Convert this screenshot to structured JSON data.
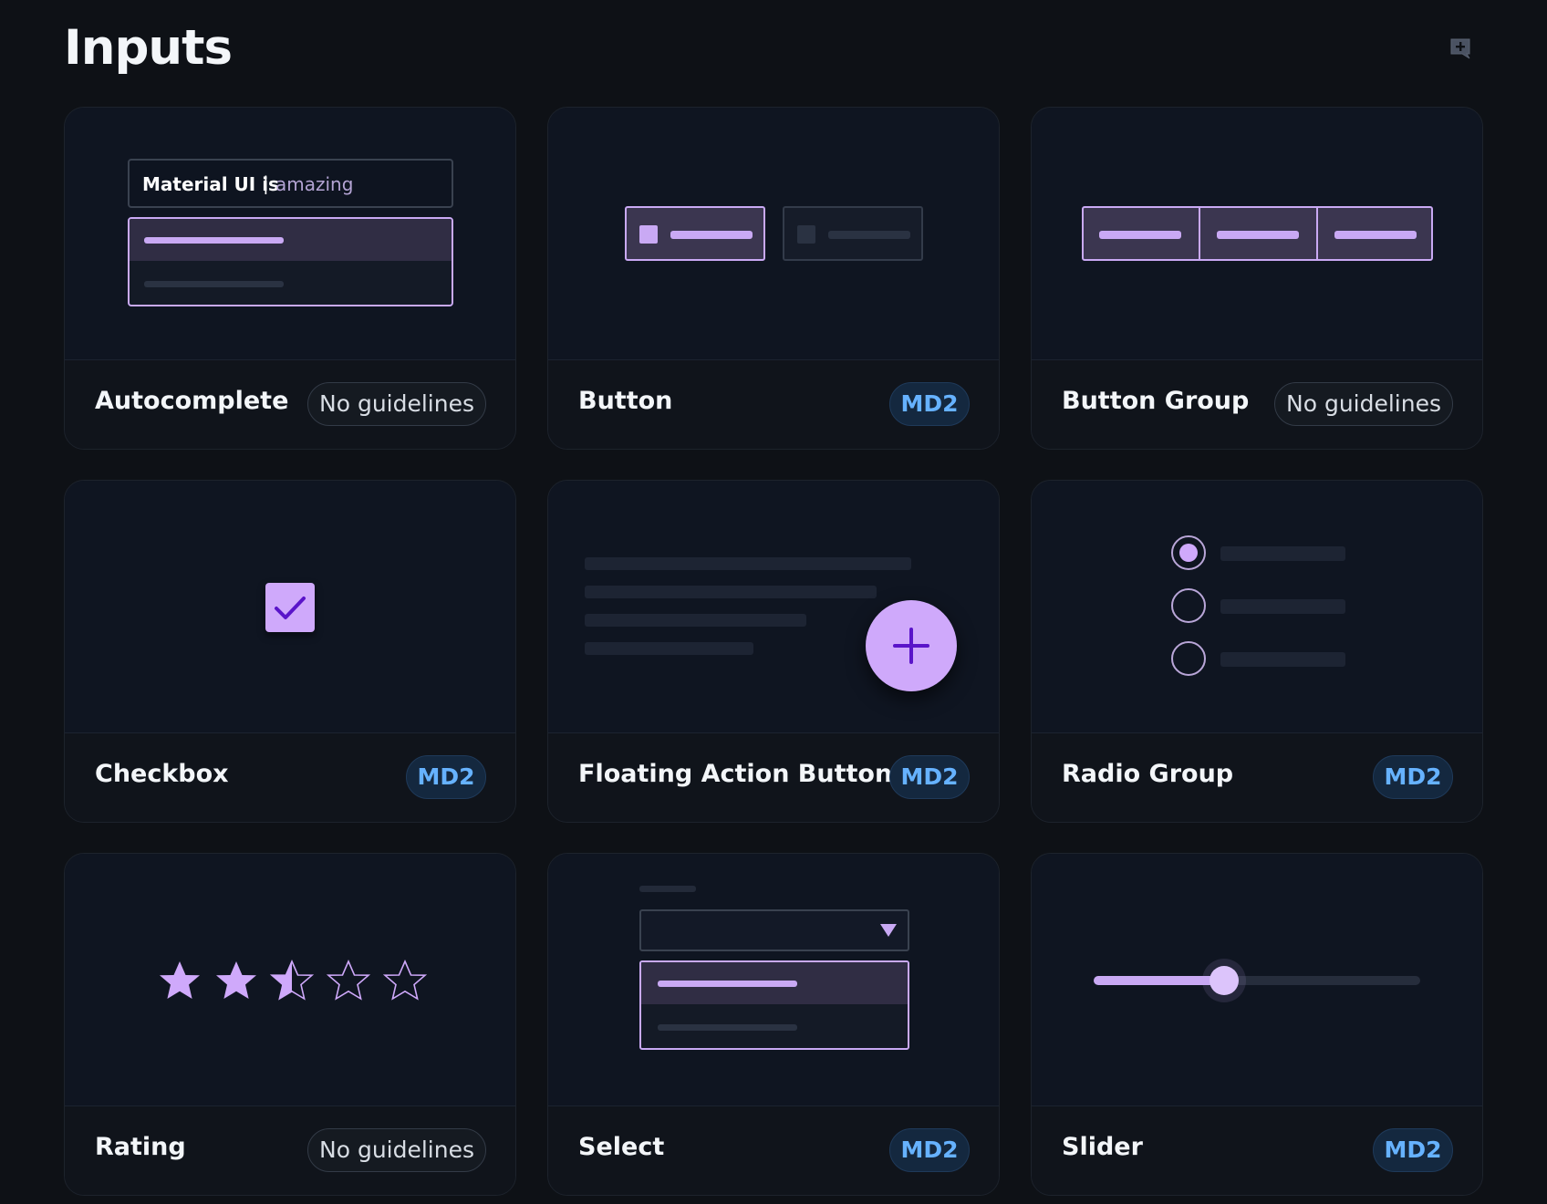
{
  "page": {
    "title": "Inputs",
    "corner_icon": "add-comment-icon"
  },
  "colors": {
    "accent": "#c9a9f4",
    "md2_chip_text": "#66b2ff",
    "background": "#0e1116"
  },
  "cards": [
    {
      "name": "Autocomplete",
      "badge": "No guidelines",
      "preview": {
        "typed": "Material UI is",
        "suggestion": "amazing"
      }
    },
    {
      "name": "Button",
      "badge": "MD2"
    },
    {
      "name": "Button Group",
      "badge": "No guidelines"
    },
    {
      "name": "Checkbox",
      "badge": "MD2",
      "preview": {
        "checked": true
      }
    },
    {
      "name": "Floating Action Button",
      "badge": "MD2",
      "preview": {
        "icon": "plus-icon"
      }
    },
    {
      "name": "Radio Group",
      "badge": "MD2",
      "preview": {
        "options": 3,
        "selected_index": 0
      }
    },
    {
      "name": "Rating",
      "badge": "No guidelines",
      "preview": {
        "value": 2.5,
        "max": 5
      }
    },
    {
      "name": "Select",
      "badge": "MD2",
      "preview": {
        "icon": "dropdown-arrow-icon"
      }
    },
    {
      "name": "Slider",
      "badge": "MD2",
      "preview": {
        "value_fraction": 0.4
      }
    }
  ]
}
